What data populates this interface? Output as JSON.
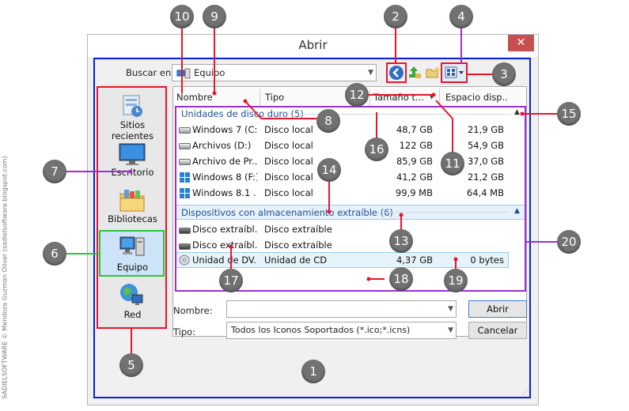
{
  "credit": "SADIELSOFTWARE © Mendoza Guzman Oliver (sadielsoftware.blogspot.com)",
  "window": {
    "title": "Abrir",
    "close_glyph": "✕"
  },
  "lookin": {
    "label": "Buscar en:",
    "value": "Equipo"
  },
  "toolbar": {
    "back_icon": "back-arrow-icon",
    "up_icon": "up-folder-icon",
    "newfolder_icon": "new-folder-icon",
    "views_icon": "views-menu-icon"
  },
  "places": [
    {
      "label": "Sitios recientes",
      "icon": "recent-places-icon"
    },
    {
      "label": "Escritorio",
      "icon": "desktop-icon"
    },
    {
      "label": "Bibliotecas",
      "icon": "libraries-icon"
    },
    {
      "label": "Equipo",
      "icon": "computer-icon"
    },
    {
      "label": "Red",
      "icon": "network-icon"
    }
  ],
  "columns": [
    "Nombre",
    "Tipo",
    "Tamaño t...",
    "Espacio disp..."
  ],
  "groups": [
    {
      "title": "Unidades de disco duro (5)",
      "rows": [
        {
          "name": "Windows 7 (C:)",
          "type": "Disco local",
          "size": "48,7 GB",
          "free": "21,9 GB"
        },
        {
          "name": "Archivos (D:)",
          "type": "Disco local",
          "size": "122 GB",
          "free": "54,9 GB"
        },
        {
          "name": "Archivo de Pr...",
          "type": "Disco local",
          "size": "85,9 GB",
          "free": "37,0 GB"
        },
        {
          "name": "Windows 8 (F:)",
          "type": "Disco local",
          "size": "41,2 GB",
          "free": "21,2 GB"
        },
        {
          "name": "Windows 8.1 ...",
          "type": "Disco local",
          "size": "99,9 MB",
          "free": "64,4 MB"
        }
      ]
    },
    {
      "title": "Dispositivos con almacenamiento extraíble (6)",
      "rows": [
        {
          "name": "Disco extraíbl...",
          "type": "Disco extraíble",
          "size": "",
          "free": ""
        },
        {
          "name": "Disco extraíbl...",
          "type": "Disco extraíble",
          "size": "",
          "free": ""
        },
        {
          "name": "Unidad de DV...",
          "type": "Unidad de CD",
          "size": "4,37 GB",
          "free": "0 bytes"
        }
      ]
    }
  ],
  "filename": {
    "label": "Nombre:",
    "value": ""
  },
  "filetype": {
    "label": "Tipo:",
    "value": "Todos los Iconos Soportados (*.ico;*.icns)"
  },
  "buttons": {
    "open": "Abrir",
    "cancel": "Cancelar"
  },
  "callouts": [
    "1",
    "2",
    "3",
    "4",
    "5",
    "6",
    "7",
    "8",
    "9",
    "10",
    "11",
    "12",
    "13",
    "14",
    "15",
    "16",
    "17",
    "18",
    "19",
    "20"
  ],
  "colors": {
    "blue": "#0a1fd9",
    "red": "#e8142c",
    "purple": "#9b2fd1",
    "green": "#2fc43a",
    "badge": "#727272",
    "close": "#c74f4f"
  }
}
